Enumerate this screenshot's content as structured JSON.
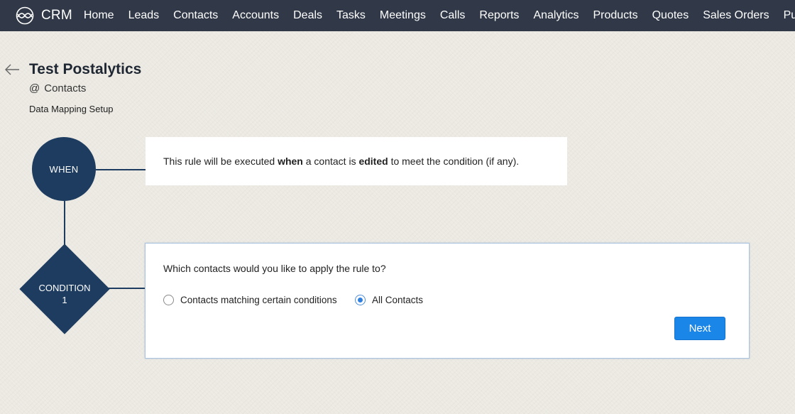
{
  "topnav": {
    "brand": "CRM",
    "items": [
      "Home",
      "Leads",
      "Contacts",
      "Accounts",
      "Deals",
      "Tasks",
      "Meetings",
      "Calls",
      "Reports",
      "Analytics",
      "Products",
      "Quotes",
      "Sales Orders",
      "Purc"
    ]
  },
  "header": {
    "title": "Test Postalytics",
    "module_prefix": "@",
    "module": "Contacts",
    "subtitle": "Data Mapping Setup"
  },
  "flow": {
    "when_label": "WHEN",
    "condition_label_line1": "CONDITION",
    "condition_label_line2": "1",
    "when_text": {
      "part1": "This rule will be executed ",
      "bold1": "when",
      "part2": " a contact is ",
      "bold2": "edited",
      "part3": " to meet the condition (if any)."
    },
    "condition_question": "Which contacts would you like to apply the rule to?",
    "options": [
      {
        "label": "Contacts matching certain conditions",
        "selected": false
      },
      {
        "label": "All Contacts",
        "selected": true
      }
    ],
    "next_label": "Next"
  },
  "colors": {
    "nav_bg": "#313949",
    "node_bg": "#1d3c60",
    "primary_button": "#1a86e8"
  },
  "icons": {
    "brand_logo": "crm-logo-icon",
    "back": "back-arrow-icon"
  }
}
